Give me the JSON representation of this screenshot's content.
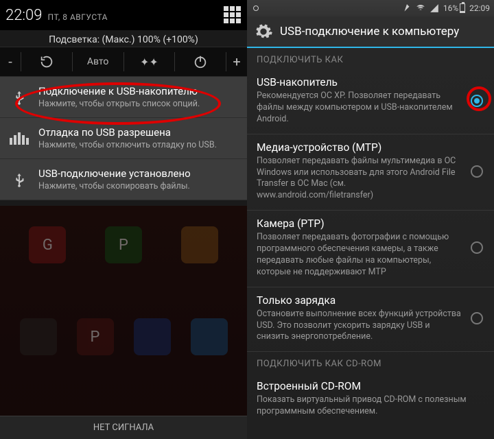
{
  "left": {
    "clock": "22:09",
    "date": "ПТ, 8 АВГУСТА",
    "brightness": "Подсветка: (Макс.) 100% (+100%)",
    "qs": {
      "minus": "-",
      "auto": "Авто",
      "plus": "+"
    },
    "notifs": [
      {
        "title": "Подключение к USB-накопителю",
        "sub": "Нажмите, чтобы открыть список опций."
      },
      {
        "title": "Отладка по USB разрешена",
        "sub": "Нажмите, чтобы отключить отладку по USB."
      },
      {
        "title": "USB-подключение установлено",
        "sub": "Нажмите, чтобы скопировать файлы."
      }
    ],
    "footer": "НЕТ СИГНАЛА"
  },
  "right": {
    "status": {
      "battery": "16%",
      "clock": "22:09"
    },
    "title": "USB-подключение к компьютеру",
    "section1": "ПОДКЛЮЧИТЬ КАК",
    "options": [
      {
        "t": "USB-накопитель",
        "d": "Рекомендуется ОС XP. Позволяет передавать файлы между компьютером и USB-накопителем Android.",
        "on": true
      },
      {
        "t": "Медиа-устройство (MTP)",
        "d": "Позволяет передавать файлы мультимедиа в ОС Windows или использовать для этого Android File Transfer в ОС Mac (см. www.android.com/filetransfer)",
        "on": false
      },
      {
        "t": "Камера (PTP)",
        "d": "Позволяет передавать фотографии с помощью программного обеспечения камеры, а также передавать любые файлы на компьютеры, которые не поддерживают MTP",
        "on": false
      },
      {
        "t": "Только зарядка",
        "d": "Остановите выполнение всех функций устройства USD. Это позволит ускорить зарядку USB и снизить энергопотребление.",
        "on": false
      }
    ],
    "section2": "ПОДКЛЮЧИТЬ КАК CD-ROM",
    "options2": [
      {
        "t": "Встроенный CD-ROM",
        "d": "Показать виртуальный привод CD-ROM с полезным программным обеспечением."
      }
    ]
  }
}
